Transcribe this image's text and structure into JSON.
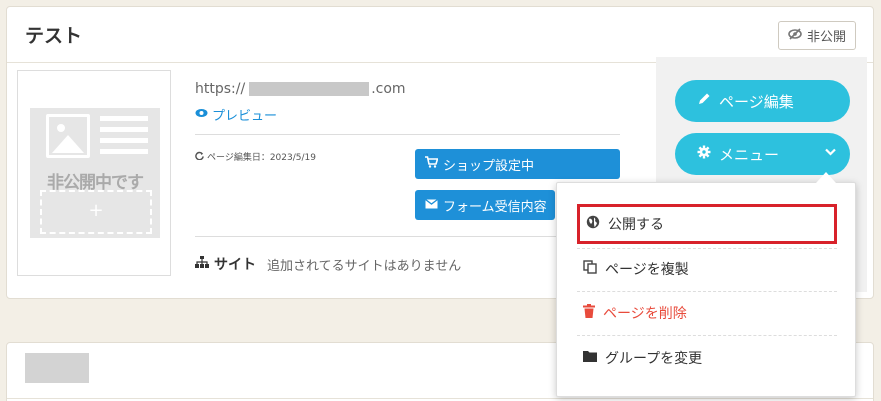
{
  "card": {
    "title": "テスト",
    "status_badge": "非公開",
    "url_prefix": "https://",
    "url_suffix": ".com",
    "preview": "プレビュー",
    "edit_date": "ページ編集日：2023/5/19",
    "shop_button": "ショップ設定中",
    "form_button": "フォーム受信内容",
    "site_label": "サイト",
    "site_none": "追加されてるサイトはありません",
    "thumbnail_text": "非公開中です",
    "thumbnail_plus": "+"
  },
  "actions": {
    "page_edit": "ページ編集",
    "menu": "メニュー"
  },
  "dropdown": {
    "items": [
      {
        "label": "公開する",
        "icon": "globe-icon"
      },
      {
        "label": "ページを複製",
        "icon": "copy-icon"
      },
      {
        "label": "ページを削除",
        "icon": "trash-icon"
      },
      {
        "label": "グループを変更",
        "icon": "folder-icon"
      }
    ]
  },
  "colors": {
    "accent_teal": "#2dc1de",
    "button_blue": "#1e90d8",
    "danger": "#e84b3c",
    "highlight_border": "#d8222a"
  }
}
